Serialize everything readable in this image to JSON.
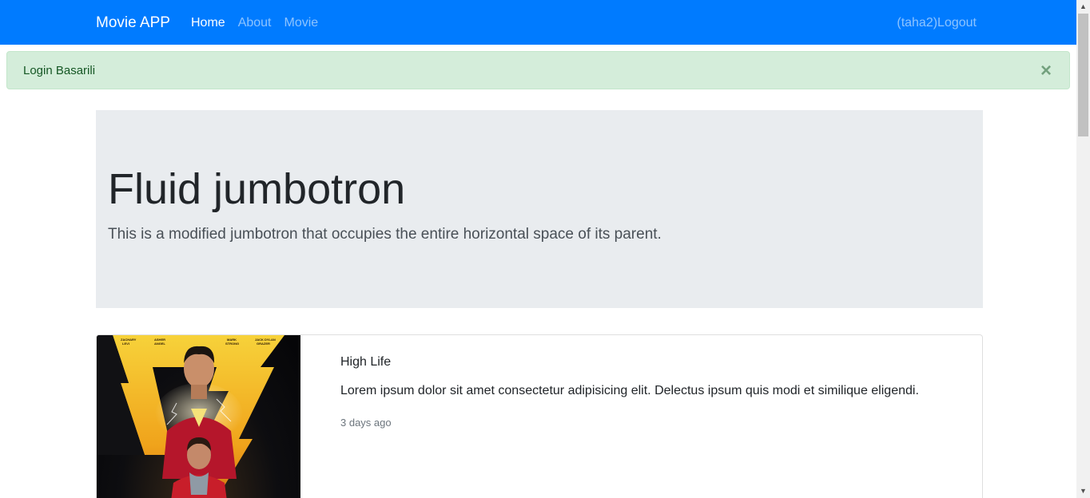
{
  "navbar": {
    "brand": "Movie APP",
    "links": [
      {
        "label": "Home",
        "active": true
      },
      {
        "label": "About",
        "active": false
      },
      {
        "label": "Movie",
        "active": false
      }
    ],
    "user_logout": "(taha2)Logout",
    "background": "#007bff"
  },
  "alert": {
    "message": "Login Basarili",
    "close_symbol": "×",
    "type": "success"
  },
  "jumbotron": {
    "title": "Fluid jumbotron",
    "lead": "This is a modified jumbotron that occupies the entire horizontal space of its parent."
  },
  "movies": [
    {
      "title": "High Life",
      "description": "Lorem ipsum dolor sit amet consectetur adipisicing elit. Delectus ipsum quis modi et similique eligendi.",
      "time": "3 days ago",
      "poster_icon": "movie-poster-image"
    }
  ],
  "scrollbar": {
    "up_icon": "▲",
    "down_icon": "▼"
  }
}
